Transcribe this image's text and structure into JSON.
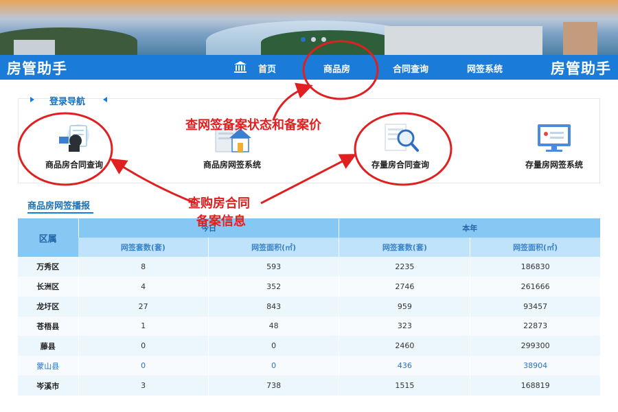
{
  "header": {
    "brand_left": "房管助手",
    "brand_right": "房管助手",
    "nav": [
      "首页",
      "商品房",
      "合同查询",
      "网签系统"
    ]
  },
  "login_nav": {
    "title": "登录导航",
    "tiles": [
      "商品房合同查询",
      "商品房网签系统",
      "存量房合同查询",
      "存量房网签系统"
    ]
  },
  "annotations": {
    "top_text": "查网签备案状态和备案价",
    "bottom_text_line1": "查购房合同",
    "bottom_text_line2": "备案信息"
  },
  "broadcast": {
    "title": "商品房网签播报",
    "headers": {
      "district": "区属",
      "today": "今日",
      "year": "本年",
      "sets": "网签套数(套)",
      "area": "网签面积(㎡)"
    },
    "rows": [
      {
        "district": "万秀区",
        "today_sets": "8",
        "today_area": "593",
        "year_sets": "2235",
        "year_area": "186830"
      },
      {
        "district": "长洲区",
        "today_sets": "4",
        "today_area": "352",
        "year_sets": "2746",
        "year_area": "261666"
      },
      {
        "district": "龙圩区",
        "today_sets": "27",
        "today_area": "843",
        "year_sets": "959",
        "year_area": "93457"
      },
      {
        "district": "苍梧县",
        "today_sets": "1",
        "today_area": "48",
        "year_sets": "323",
        "year_area": "22873"
      },
      {
        "district": "藤县",
        "today_sets": "0",
        "today_area": "0",
        "year_sets": "2460",
        "year_area": "299300"
      },
      {
        "district": "蒙山县",
        "today_sets": "0",
        "today_area": "0",
        "year_sets": "436",
        "year_area": "38904"
      },
      {
        "district": "岑溪市",
        "today_sets": "3",
        "today_area": "738",
        "year_sets": "1515",
        "year_area": "168819"
      }
    ]
  },
  "colors": {
    "nav_bg": "#1a7cd8",
    "annotation": "#e02020",
    "header_dark": "#87c7f3",
    "header_light": "#bfe3fa"
  }
}
